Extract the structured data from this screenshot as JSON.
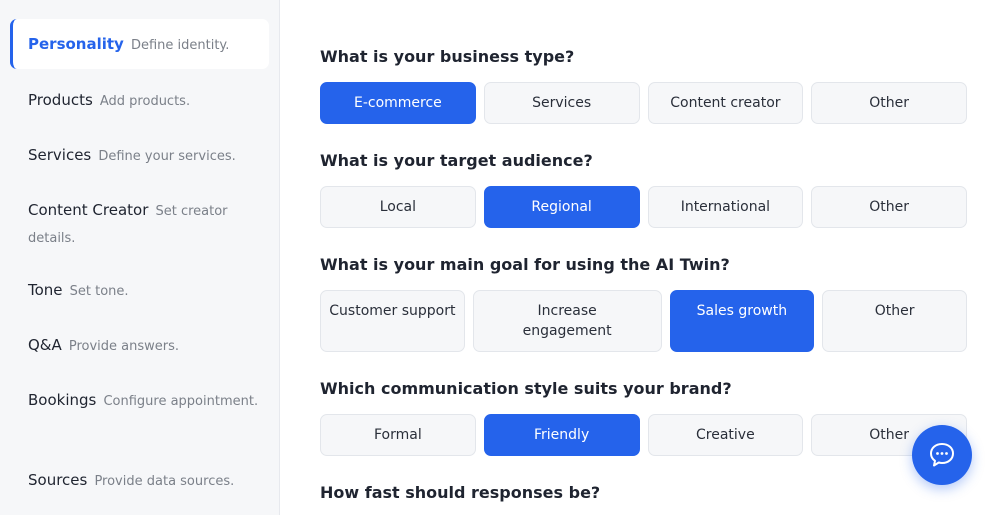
{
  "sidebar": {
    "items": [
      {
        "title": "Personality",
        "desc": "Define identity."
      },
      {
        "title": "Products",
        "desc": "Add products."
      },
      {
        "title": "Services",
        "desc": "Define your services."
      },
      {
        "title": "Content Creator",
        "desc": "Set creator details."
      },
      {
        "title": "Tone",
        "desc": "Set tone."
      },
      {
        "title": "Q&A",
        "desc": "Provide answers."
      },
      {
        "title": "Bookings",
        "desc": "Configure appointment."
      },
      {
        "title": "Sources",
        "desc": "Provide data sources."
      }
    ],
    "active_index": 0
  },
  "questions": [
    {
      "text": "What is your business type?",
      "options": [
        "E-commerce",
        "Services",
        "Content creator",
        "Other"
      ],
      "selected": 0
    },
    {
      "text": "What is your target audience?",
      "options": [
        "Local",
        "Regional",
        "International",
        "Other"
      ],
      "selected": 1
    },
    {
      "text": "What is your main goal for using the AI Twin?",
      "options": [
        "Customer support",
        "Increase engagement",
        "Sales growth",
        "Other"
      ],
      "selected": 2
    },
    {
      "text": "Which communication style suits your brand?",
      "options": [
        "Formal",
        "Friendly",
        "Creative",
        "Other"
      ],
      "selected": 1
    },
    {
      "text": "How fast should responses be?",
      "options": [],
      "selected": null
    }
  ],
  "chat": {
    "icon": "chat-bubble-icon"
  },
  "colors": {
    "accent": "#2563eb",
    "sidebar_bg": "#f6f7f9",
    "option_bg": "#f6f7f9"
  }
}
